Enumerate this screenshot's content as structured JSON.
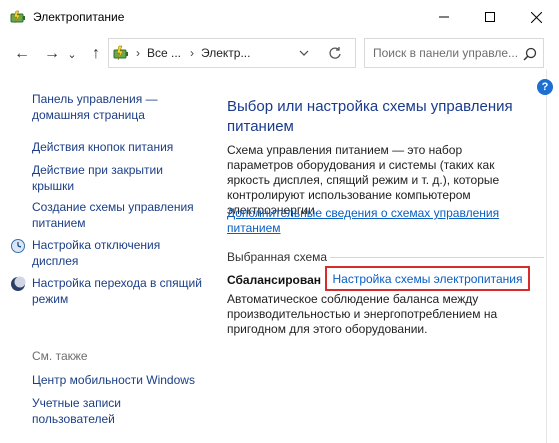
{
  "window": {
    "title": "Электропитание",
    "minimize_glyph": "—",
    "maximize_glyph": "☐",
    "close_glyph": "✕"
  },
  "nav": {
    "back_glyph": "←",
    "forward_glyph": "→",
    "dropdown_glyph": "⌄",
    "up_glyph": "↑"
  },
  "address": {
    "crumbs": [
      "Все ...",
      "Электр..."
    ],
    "separator": "›"
  },
  "search": {
    "placeholder": "Поиск в панели управле..."
  },
  "help_label": "?",
  "sidebar": {
    "home_link": "Панель управления — домашняя страница",
    "items": [
      "Действия кнопок питания",
      "Действие при закрытии крышки",
      "Создание схемы управления питанием",
      "Настройка отключения дисплея",
      "Настройка перехода в спящий режим"
    ],
    "see_also_label": "См. также",
    "see_also": [
      "Центр мобильности Windows",
      "Учетные записи пользователей"
    ]
  },
  "main": {
    "title": "Выбор или настройка схемы управления питанием",
    "description": "Схема управления питанием — это набор параметров оборудования и системы (таких как яркость дисплея, спящий режим и т. д.), которые контролируют использование компьютером электроэнергии.",
    "more_link": "Дополнительные сведения о схемах управления питанием",
    "selected_header": "Выбранная схема",
    "scheme_name": "Сбалансирован",
    "scheme_link": "Настройка схемы электропитания",
    "scheme_description": "Автоматическое соблюдение баланса между производительностью и энергопотреблением на пригодном для этого оборудовании."
  },
  "colors": {
    "link": "#0a5ec2",
    "sidebar_link": "#1b3e86",
    "title_blue": "#1a3b8c",
    "highlight_border": "#d72c2c"
  },
  "icons": [
    "power-options-icon",
    "display-timeout-icon",
    "sleep-moon-icon",
    "refresh-icon",
    "search-icon",
    "help-icon"
  ]
}
